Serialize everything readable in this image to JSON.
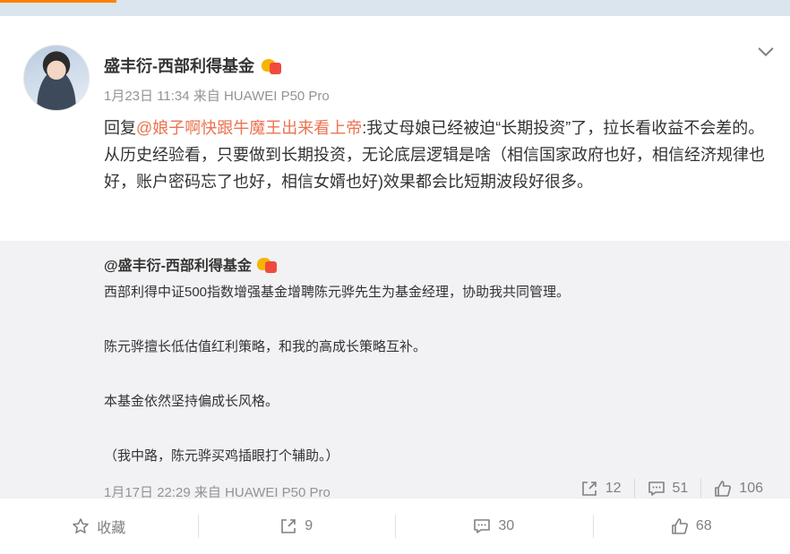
{
  "post": {
    "author": "盛丰衍-西部利得基金",
    "meta": "1月23日 11:34 来自 HUAWEI P50 Pro",
    "reply_prefix": "回复",
    "mention": "@娘子啊快跟牛魔王出来看上帝",
    "body": ":我丈母娘已经被迫“长期投资”了，拉长看收益不会差的。 从历史经验看，只要做到长期投资，无论底层逻辑是啥（相信国家政府也好，相信经济规律也好，账户密码忘了也好，相信女婿也好)效果都会比短期波段好很多。"
  },
  "repost": {
    "author": "@盛丰衍-西部利得基金",
    "paragraphs": [
      "西部利得中证500指数增强基金增聘陈元骅先生为基金经理，协助我共同管理。",
      "陈元骅擅长低估值红利策略，和我的高成长策略互补。",
      "本基金依然坚持偏成长风格。",
      "（我中路，陈元骅买鸡插眼打个辅助。）"
    ],
    "meta": "1月17日 22:29 来自 HUAWEI P50 Pro",
    "actions": {
      "repost_count": "12",
      "comment_count": "51",
      "like_count": "106"
    }
  },
  "footer": {
    "favorite_label": "收藏",
    "repost_count": "9",
    "comment_count": "30",
    "like_count": "68"
  },
  "icons": {
    "chevron": "chevron-down-icon",
    "star": "star-icon",
    "repost": "share-arrow-icon",
    "comment": "comment-bubble-icon",
    "like": "thumbs-up-icon"
  },
  "colors": {
    "accent": "#ff8200",
    "mention": "#eb7350",
    "meta": "#939393",
    "repost_bg": "#f2f2f5"
  }
}
